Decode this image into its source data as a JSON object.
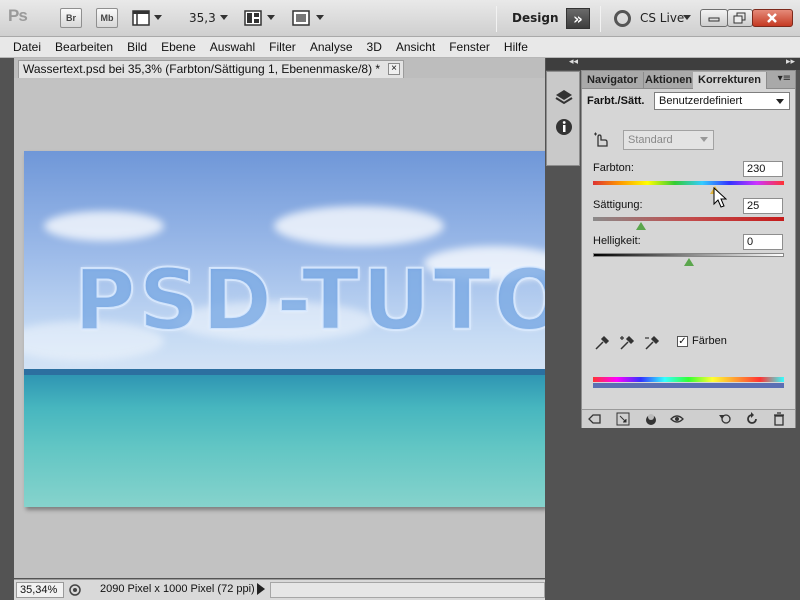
{
  "app": {
    "logo": "Ps",
    "bridge_label": "Br",
    "minibridge_label": "Mb",
    "zoom_value": "35,3",
    "workspace": "Design",
    "cslive": "CS Live"
  },
  "menu": [
    "Datei",
    "Bearbeiten",
    "Bild",
    "Ebene",
    "Auswahl",
    "Filter",
    "Analyse",
    "3D",
    "Ansicht",
    "Fenster",
    "Hilfe"
  ],
  "document": {
    "tab_title": "Wassertext.psd bei 35,3% (Farbton/Sättigung 1, Ebenenmaske/8) *",
    "tab_close": "×",
    "canvas_text": "PSD-TUTOR"
  },
  "status": {
    "zoom": "35,34%",
    "info": "2090 Pixel x 1000 Pixel (72 ppi)"
  },
  "panel": {
    "tabs": [
      "Navigator",
      "Aktionen",
      "Korrekturen"
    ],
    "active_tab": "Korrekturen",
    "title": "Farbt./Sätt.",
    "preset": "Benutzerdefiniert",
    "channel": "Standard",
    "hue_label": "Farbton:",
    "hue_value": "230",
    "sat_label": "Sättigung:",
    "sat_value": "25",
    "light_label": "Helligkeit:",
    "light_value": "0",
    "colorize_label": "Färben",
    "colorize_checked": "✓",
    "hue_slider": 0.64,
    "sat_slider": 0.25,
    "light_slider": 0.5
  },
  "colors": {
    "accent_close": "#c53a23",
    "panel_bg": "#d6d6d6",
    "app_dark": "#535353"
  }
}
